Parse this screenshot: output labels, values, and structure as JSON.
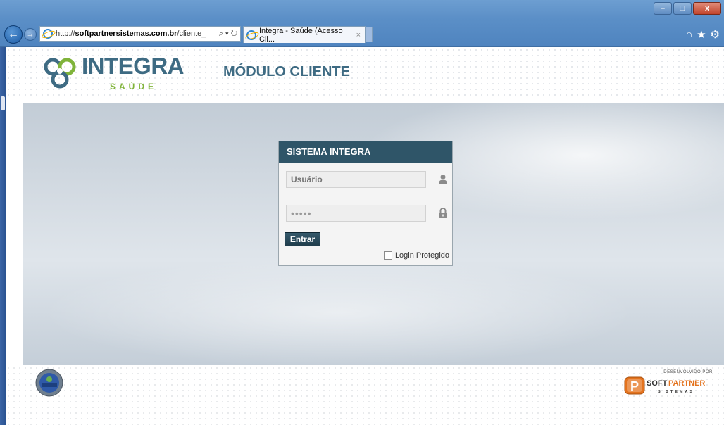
{
  "browser": {
    "url_prefix": "http://",
    "url_domain": "softpartnersistemas.com.br",
    "url_path": "/cliente_",
    "tab_title": "Integra - Saúde (Acesso Cli...",
    "tab_close": "×",
    "address_tools": "⌕ ▾ ↻"
  },
  "header": {
    "logo_text": "INTEGRA",
    "logo_sub": "SAÚDE",
    "module_title": "MÓDULO CLIENTE"
  },
  "login": {
    "title": "SISTEMA INTEGRA",
    "username_placeholder": "Usuário",
    "password_value": "•••••",
    "submit_label": "Entrar",
    "protected_label": "Login Protegido",
    "protected_checked": false
  },
  "footer": {
    "developed_by": "DESENVOLVIDO POR:",
    "partner_name_soft": "SOFT",
    "partner_name_partner": "PARTNER",
    "partner_sub": "SISTEMAS",
    "seal_text": "POSITIVE SSL"
  },
  "colors": {
    "brand": "#3e6b83",
    "accent": "#7fb33a",
    "login_header": "#2f5568",
    "partner_orange": "#e4731e"
  }
}
